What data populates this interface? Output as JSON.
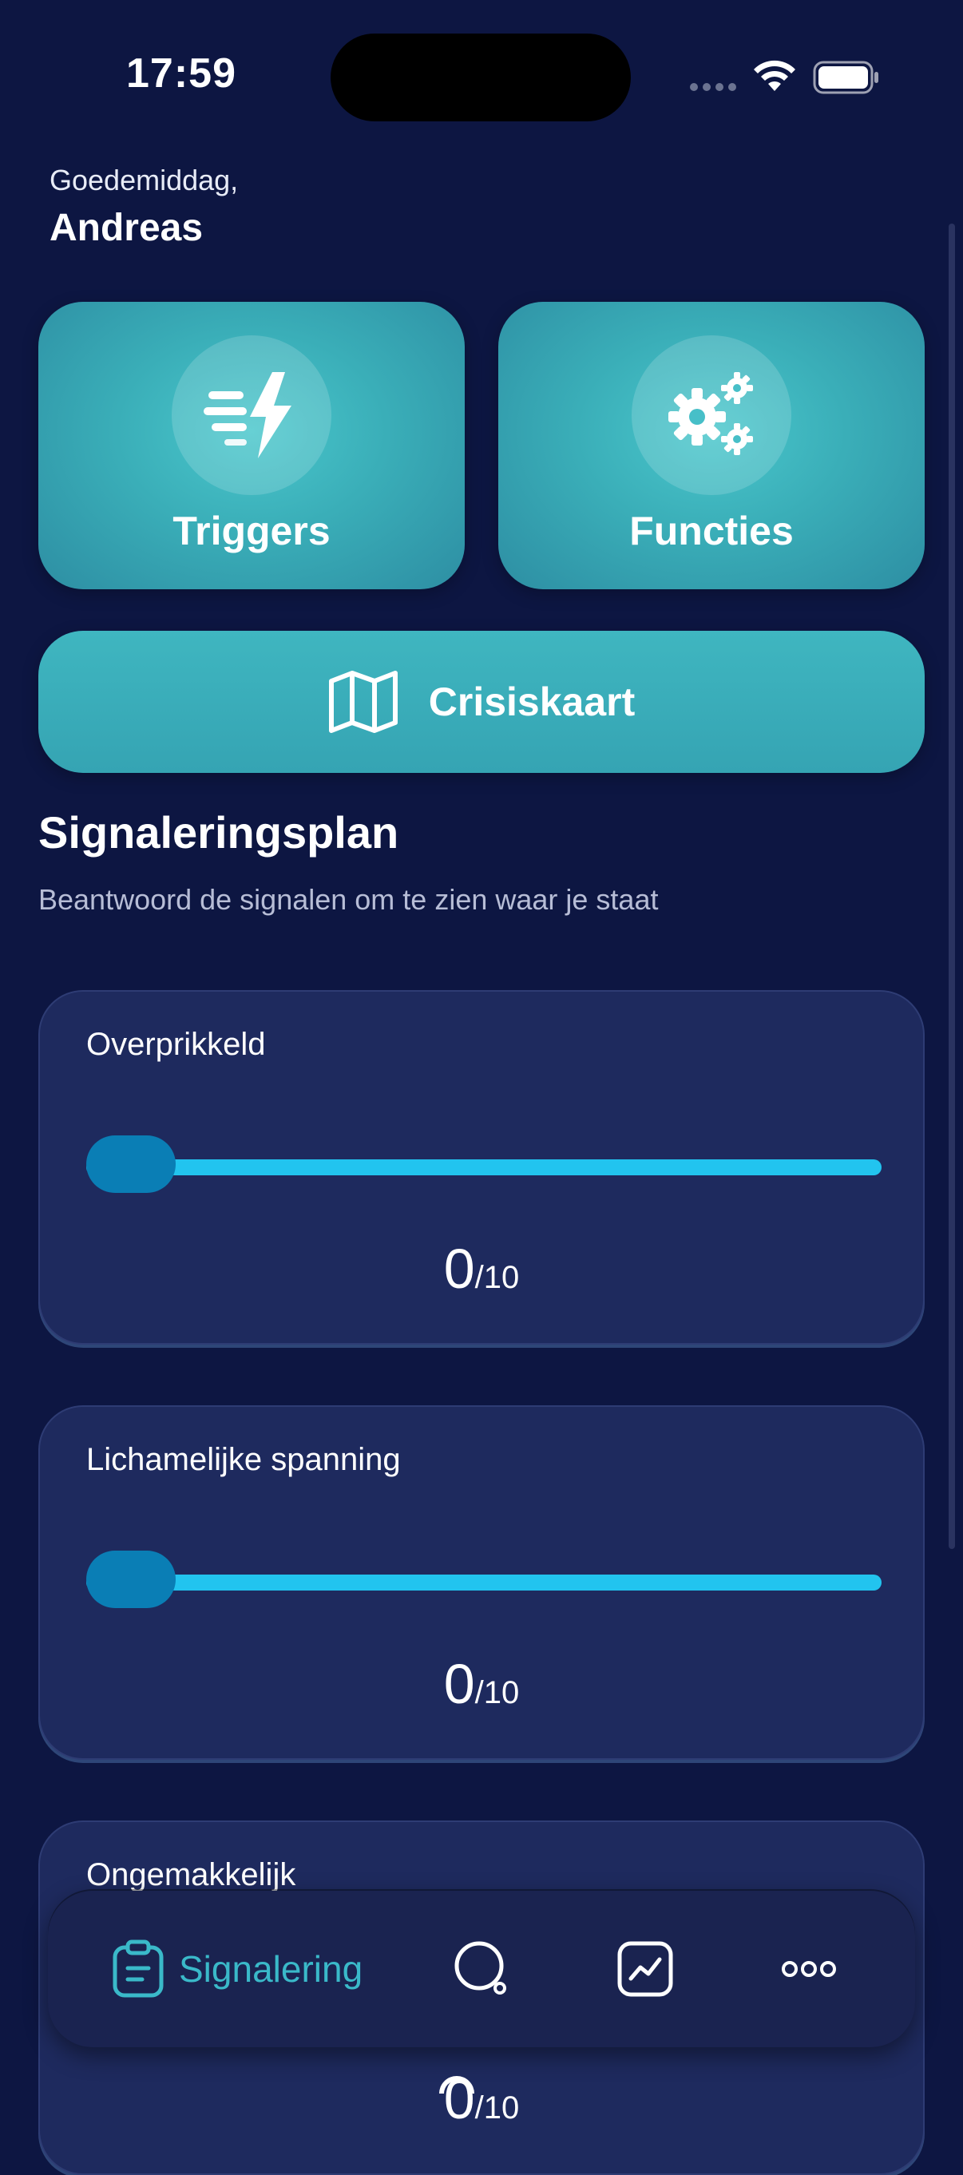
{
  "status_bar": {
    "time": "17:59"
  },
  "header": {
    "greeting": "Goedemiddag,",
    "name": "Andreas"
  },
  "tiles": [
    {
      "label": "Triggers",
      "icon": "lightning-speed-icon"
    },
    {
      "label": "Functies",
      "icon": "gears-icon"
    }
  ],
  "crisis_button": {
    "label": "Crisiskaart",
    "icon": "map-icon"
  },
  "section": {
    "title": "Signaleringsplan",
    "subtitle": "Beantwoord de signalen om te zien waar je staat"
  },
  "signals": [
    {
      "label": "Overprikkeld",
      "value": "0",
      "max": "/10"
    },
    {
      "label": "Lichamelijke spanning",
      "value": "0",
      "max": "/10"
    },
    {
      "label": "Ongemakkelijk",
      "value": "0",
      "max": "/10"
    }
  ],
  "bottom_nav": {
    "items": [
      {
        "label": "Signalering",
        "icon": "clipboard-icon",
        "active": true
      },
      {
        "label": "",
        "icon": "search-icon"
      },
      {
        "label": "",
        "icon": "chart-icon"
      },
      {
        "label": "",
        "icon": "more-icon"
      }
    ]
  },
  "colors": {
    "background": "#0d1642",
    "accent": "#3ab9c9",
    "card": "#1e2a5e",
    "slider_track": "#22c4ef",
    "slider_thumb": "#0a7eb5"
  }
}
